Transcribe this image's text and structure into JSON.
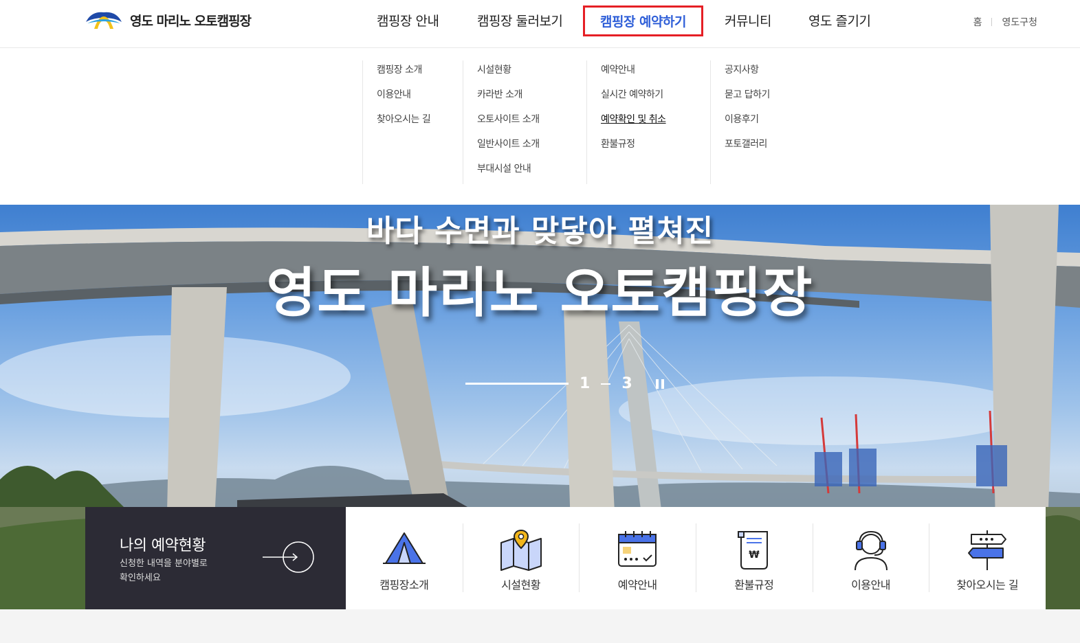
{
  "header": {
    "logo_text": "영도 마리노 오토캠핑장",
    "nav": [
      {
        "label": "캠핑장 안내"
      },
      {
        "label": "캠핑장 둘러보기"
      },
      {
        "label": "캠핑장 예약하기",
        "active": true
      },
      {
        "label": "커뮤니티"
      },
      {
        "label": "영도 즐기기"
      }
    ],
    "util": {
      "home": "홈",
      "district": "영도구청"
    }
  },
  "mega_menu": [
    {
      "items": [
        "캠핑장 소개",
        "이용안내",
        "찾아오시는 길"
      ]
    },
    {
      "items": [
        "시설현황",
        "카라반 소개",
        "오토사이트 소개",
        "일반사이트 소개",
        "부대시설 안내"
      ]
    },
    {
      "items": [
        "예약안내",
        "실시간 예약하기",
        "예약확인 및 취소",
        "환불규정"
      ],
      "current_index": 2
    },
    {
      "items": [
        "공지사항",
        "묻고 답하기",
        "이용후기",
        "포토갤러리"
      ]
    }
  ],
  "hero": {
    "subtitle": "바다 수면과 맞닿아 펼쳐진",
    "title": "영도 마리노 오토캠핑장",
    "slider": {
      "current": "1",
      "total": "3",
      "progress_fraction": 1.0
    }
  },
  "my_reservation": {
    "title": "나의 예약현황",
    "desc": "신청한 내역을 분야별로\n확인하세요"
  },
  "quick_menu": [
    {
      "label": "캠핑장소개",
      "icon": "tent-icon"
    },
    {
      "label": "시설현황",
      "icon": "map-pin-icon"
    },
    {
      "label": "예약안내",
      "icon": "calendar-check-icon"
    },
    {
      "label": "환불규정",
      "icon": "receipt-won-icon"
    },
    {
      "label": "이용안내",
      "icon": "headset-agent-icon"
    },
    {
      "label": "찾아오시는 길",
      "icon": "signpost-icon"
    }
  ],
  "colors": {
    "accent_blue": "#2f5fd8",
    "highlight_red": "#e51f25",
    "dark_panel": "#2c2b35",
    "icon_blue": "#4a73e8"
  }
}
